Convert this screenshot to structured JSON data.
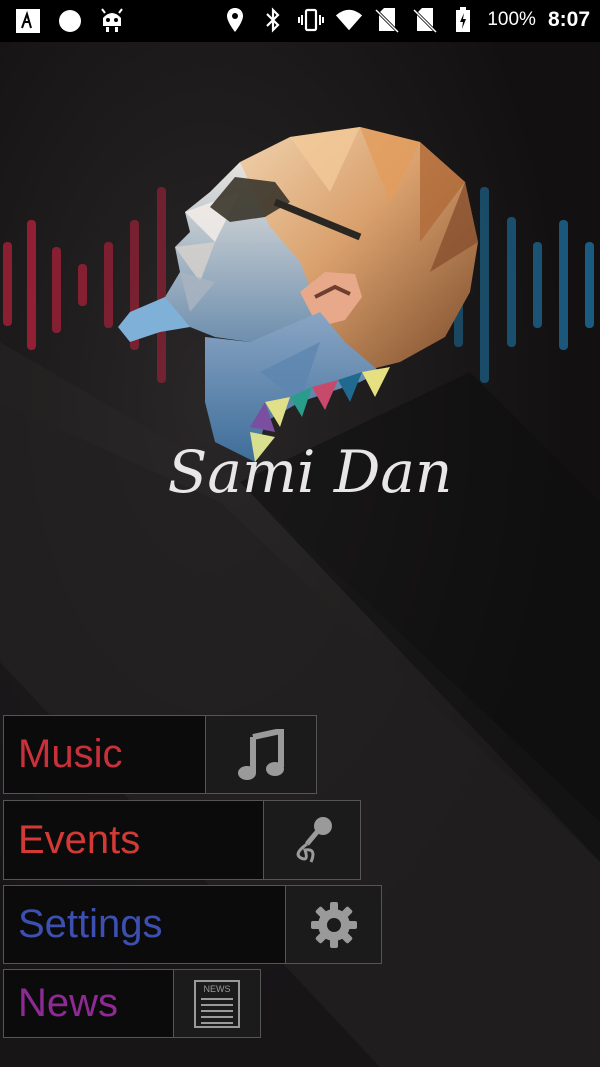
{
  "status_bar": {
    "battery_text": "100%",
    "time": "8:07",
    "icons": [
      "app-notification-icon",
      "circle-icon",
      "android-bot-icon",
      "location-icon",
      "bluetooth-icon",
      "vibrate-icon",
      "wifi-icon",
      "no-sim-icon",
      "no-sim-icon-2",
      "battery-charging-icon"
    ]
  },
  "hero": {
    "artist_signature": "Sami Dan",
    "image": "low-poly-artist-portrait"
  },
  "menu": {
    "items": [
      {
        "label": "Music",
        "icon": "music-note-icon",
        "color": "#c8313a"
      },
      {
        "label": "Events",
        "icon": "microphone-icon",
        "color": "#d23a36"
      },
      {
        "label": "Settings",
        "icon": "gear-icon",
        "color": "#3d4fb0"
      },
      {
        "label": "News",
        "icon": "newspaper-icon",
        "color": "#8e2a93",
        "icon_text": "NEWS"
      }
    ]
  },
  "colors": {
    "background": "#131112",
    "status_bar": "#000000",
    "equalizer_left": "#b0213b",
    "equalizer_right": "#1d6f9e"
  }
}
